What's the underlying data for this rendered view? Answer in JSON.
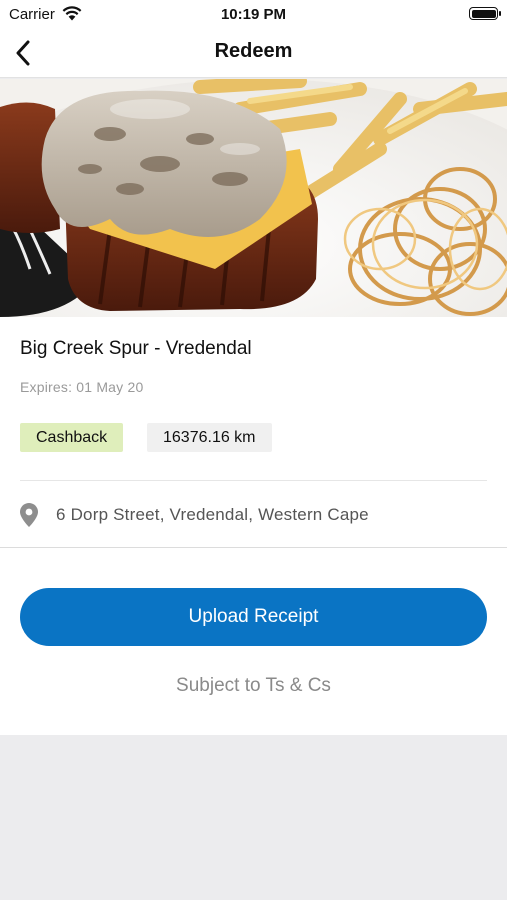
{
  "status_bar": {
    "carrier": "Carrier",
    "time": "10:19 PM",
    "wifi_icon": "wifi-icon",
    "battery_icon": "battery-icon",
    "battery_level": 1.0
  },
  "nav": {
    "title": "Redeem",
    "back_icon": "chevron-left-icon"
  },
  "hero": {
    "image": "steak-with-mushroom-sauce-fries-onion-rings-photo"
  },
  "offer": {
    "store_name": "Big Creek Spur - Vredendal",
    "expires": "Expires: 01 May 20",
    "tags": {
      "type": "Cashback",
      "distance": "16376.16 km"
    },
    "address_icon": "location-pin-icon",
    "address": "6 Dorp Street, Vredendal, Western Cape"
  },
  "actions": {
    "upload_label": "Upload Receipt",
    "terms_label": "Subject to Ts & Cs"
  },
  "colors": {
    "primary_button": "#0a74c4",
    "cashback_tag": "#dfeebb",
    "distance_tag": "#f0f0f0",
    "muted_text": "#9a9a9a",
    "background": "#ececee"
  }
}
